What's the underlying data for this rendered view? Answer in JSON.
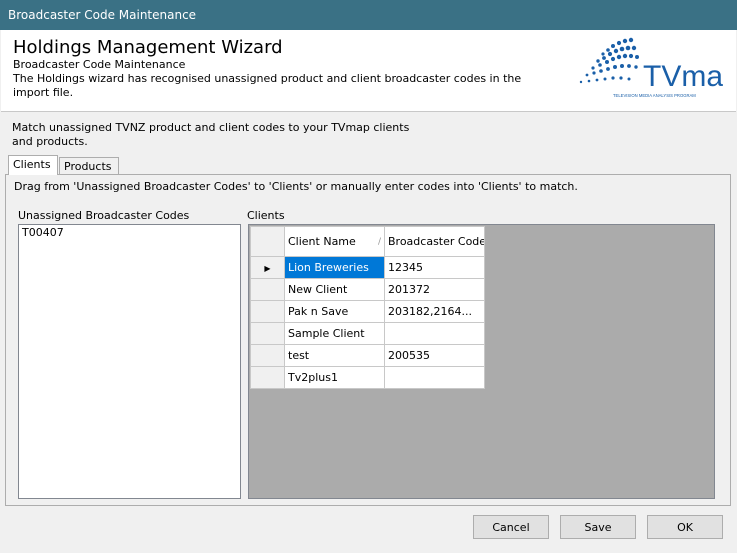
{
  "window": {
    "title": "Broadcaster Code Maintenance"
  },
  "header": {
    "title": "Holdings Management Wizard",
    "subtitle": "Broadcaster Code Maintenance",
    "description": "The Holdings wizard has recognised unassigned product and client broadcaster codes in the import file.",
    "logo_text": "TVmap",
    "logo_tagline": "TELEVISION MEDIA ANALYSIS PROGRAM"
  },
  "instructions": "Match unassigned TVNZ product and client codes to your TVmap clients and products.",
  "tabs": [
    {
      "label": "Clients",
      "active": true
    },
    {
      "label": "Products",
      "active": false
    }
  ],
  "drag_note": "Drag from 'Unassigned Broadcaster Codes' to 'Clients' or manually enter codes into 'Clients' to match.",
  "unassigned": {
    "label": "Unassigned Broadcaster Codes",
    "items": [
      "T00407"
    ]
  },
  "clients": {
    "label": "Clients",
    "columns": [
      "Client Name",
      "Broadcaster Code"
    ],
    "rows": [
      {
        "name": "Lion Breweries",
        "code": "12345",
        "selected": true
      },
      {
        "name": "New Client",
        "code": "201372"
      },
      {
        "name": "Pak n Save",
        "code": "203182,2164..."
      },
      {
        "name": "Sample Client",
        "code": ""
      },
      {
        "name": "test",
        "code": "200535"
      },
      {
        "name": "Tv2plus1",
        "code": ""
      }
    ]
  },
  "buttons": {
    "cancel": "Cancel",
    "save": "Save",
    "ok": "OK"
  },
  "colors": {
    "titlebar": "#3a7185",
    "selection": "#0078d7",
    "logo_blue": "#1a5fa8"
  }
}
